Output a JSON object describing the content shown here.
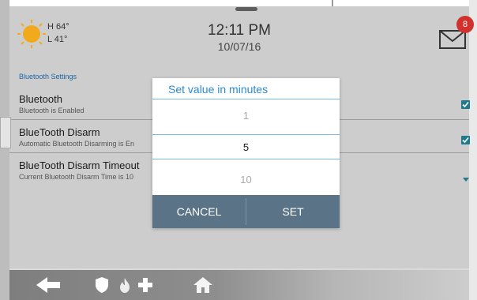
{
  "weather": {
    "high": "H 64°",
    "low": "L 41°",
    "icon": "sun-icon"
  },
  "clock": {
    "time": "12:11 PM",
    "date": "10/07/16"
  },
  "messages": {
    "badge": "8",
    "icon": "mail-icon"
  },
  "section": {
    "label": "Bluetooth Settings"
  },
  "settings": [
    {
      "title": "Bluetooth",
      "subtitle": "Bluetooth is Enabled",
      "control": "checkbox-checked"
    },
    {
      "title": "BlueTooth Disarm",
      "subtitle": "Automatic Bluetooth Disarming is En",
      "control": "checkbox-checked"
    },
    {
      "title": "BlueTooth Disarm Timeout",
      "subtitle": "Current Bluetooth Disarm Time is 10",
      "control": "dropdown"
    }
  ],
  "dialog": {
    "title": "Set value in minutes",
    "options": [
      "1",
      "5",
      "10"
    ],
    "selected": "5",
    "cancel_label": "CANCEL",
    "set_label": "SET"
  },
  "bottombar": {
    "icons": [
      "back-arrow-icon",
      "shield-icon",
      "fire-icon",
      "medical-cross-icon",
      "home-icon"
    ]
  },
  "colors": {
    "accent": "#2a8ad6",
    "dialog_buttons": "#5a7386",
    "check": "#1e7a8c",
    "badge": "#d0312d"
  }
}
